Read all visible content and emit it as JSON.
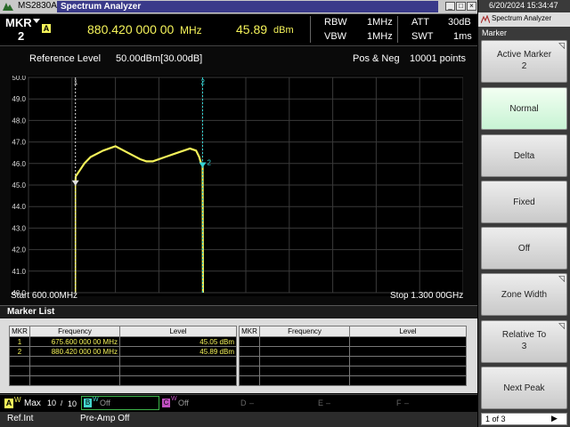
{
  "window": {
    "model": "MS2830A",
    "app_title": "Spectrum Analyzer"
  },
  "header": {
    "mkr_label": "MKR",
    "mkr_number": "2",
    "mkr_badge": "A",
    "frequency": "880.420 000 00",
    "frequency_unit": "MHz",
    "level": "45.89",
    "level_unit": "dBm",
    "rbw_label": "RBW",
    "rbw_value": "1MHz",
    "vbw_label": "VBW",
    "vbw_value": "1MHz",
    "att_label": "ATT",
    "att_value": "30dB",
    "swt_label": "SWT",
    "swt_value": "1ms"
  },
  "graph": {
    "ref_label": "Reference Level",
    "ref_value": "50.00dBm[30.00dB]",
    "detector": "Pos & Neg",
    "points": "10001 points",
    "start": "Start 600.00MHz",
    "stop": "Stop 1.300 00GHz",
    "marker1_tag": "1",
    "marker2_tag": "2",
    "marker2_flag": "2"
  },
  "chart_data": {
    "type": "line",
    "xlim": [
      600,
      1300
    ],
    "ylim": [
      40.0,
      50.0
    ],
    "ytick_labels": [
      "50.0",
      "49.0",
      "48.0",
      "47.0",
      "46.0",
      "45.0",
      "44.0",
      "43.0",
      "42.0",
      "41.0",
      "40.0"
    ],
    "series": [
      {
        "x": [
          675.6,
          676,
          690,
          700,
          720,
          740,
          760,
          780,
          790,
          800,
          820,
          840,
          860,
          870,
          875,
          878,
          880.42,
          881
        ],
        "values": [
          45.05,
          45.4,
          46.0,
          46.3,
          46.6,
          46.8,
          46.5,
          46.2,
          46.1,
          46.1,
          46.3,
          46.5,
          46.7,
          46.6,
          46.3,
          46.0,
          45.89,
          40.0
        ]
      }
    ],
    "markers": [
      {
        "id": "1",
        "x": 675.6,
        "y": 45.05
      },
      {
        "id": "2",
        "x": 880.42,
        "y": 45.89
      }
    ]
  },
  "marker_list": {
    "title": "Marker List",
    "columns": [
      "MKR",
      "Frequency",
      "Level"
    ],
    "rows": [
      {
        "mkr": "1",
        "freq": "675.600 000 00 MHz",
        "level": "45.05 dBm"
      },
      {
        "mkr": "2",
        "freq": "880.420 000 00 MHz",
        "level": "45.89 dBm"
      }
    ]
  },
  "traces": {
    "a_label": "Max",
    "a_count": "10",
    "a_sep": "/",
    "a_total": "10",
    "b_state": "Off",
    "c_state": "Off",
    "d_state": "–",
    "e_state": "–",
    "f_state": "–",
    "letters": [
      "A",
      "B",
      "C",
      "D",
      "E",
      "F"
    ],
    "w_mark": "W"
  },
  "status": {
    "ref": "Ref.Int",
    "preamp": "Pre-Amp Off"
  },
  "panel": {
    "datetime": "6/20/2024 15:34:47",
    "app": "Spectrum Analyzer",
    "menu": "Marker",
    "keys": [
      {
        "label": "Active Marker",
        "sub": "2"
      },
      {
        "label": "Normal",
        "sub": ""
      },
      {
        "label": "Delta",
        "sub": ""
      },
      {
        "label": "Fixed",
        "sub": ""
      },
      {
        "label": "Off",
        "sub": ""
      },
      {
        "label": "Zone Width",
        "sub": ""
      },
      {
        "label": "Relative To",
        "sub": "3"
      },
      {
        "label": "Next Peak",
        "sub": ""
      }
    ],
    "page": "1 of 3"
  },
  "colors": {
    "trace": "#f5f35a",
    "marker_active": "#33d6d6",
    "marker_inactive": "#e0e0e0",
    "grid": "#3a3a3a"
  }
}
